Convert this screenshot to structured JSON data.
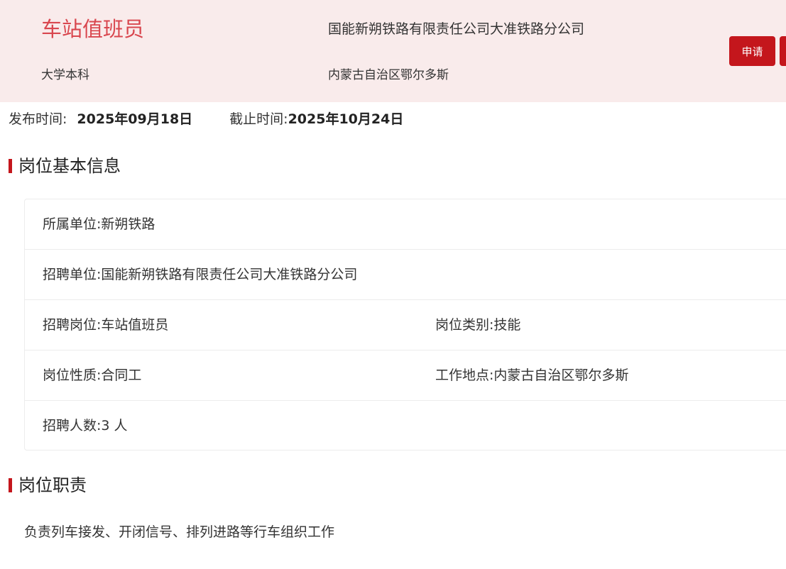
{
  "header": {
    "job_title": "车站值班员",
    "education": "大学本科",
    "company": "国能新朔铁路有限责任公司大准铁路分公司",
    "location": "内蒙古自治区鄂尔多斯",
    "apply_label": "申请"
  },
  "dates": {
    "publish_label": "发布时间:",
    "publish_value": "2025年09月18日",
    "deadline_label": "截止时间:",
    "deadline_value": "2025年10月24日"
  },
  "basic_info": {
    "title": "岗位基本信息",
    "rows": [
      {
        "left": "所属单位:新朔铁路",
        "right": ""
      },
      {
        "left": "招聘单位:国能新朔铁路有限责任公司大准铁路分公司",
        "right": ""
      },
      {
        "left": "招聘岗位:车站值班员",
        "right": "岗位类别:技能"
      },
      {
        "left": "岗位性质:合同工",
        "right": "工作地点:内蒙古自治区鄂尔多斯"
      },
      {
        "left": "招聘人数:3 人",
        "right": ""
      }
    ]
  },
  "duties": {
    "title": "岗位职责",
    "text": "负责列车接发、开闭信号、排列进路等行车组织工作"
  },
  "colors": {
    "accent": "#c4161c",
    "title_red": "#d9474f",
    "header_bg": "#f9ebeb"
  }
}
